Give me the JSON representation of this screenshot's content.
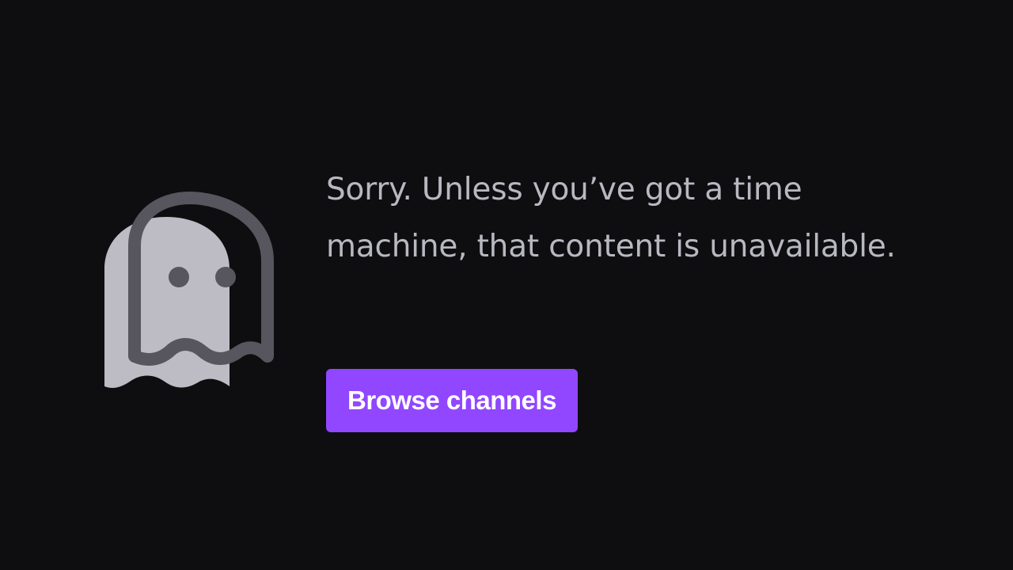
{
  "error_page": {
    "message": "Sorry. Unless you’ve got a time machine, that content is unavailable.",
    "button_label": "Browse channels",
    "illustration_icon": "ghost-icon"
  },
  "colors": {
    "background": "#0e0e10",
    "text": "#b8b8c2",
    "accent": "#9147ff",
    "ghost_fill": "#bdbcc4",
    "ghost_outline": "#57555e"
  }
}
